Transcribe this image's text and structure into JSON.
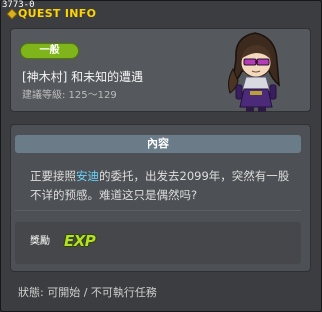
{
  "window": {
    "quest_id": "3773-0",
    "title": "QUEST INFO"
  },
  "quest": {
    "badge": "一般",
    "name": "[神木村] 和未知的遭遇",
    "level_range": "建議等級: 125～129"
  },
  "content": {
    "header": "內容",
    "description_before": "正要接照",
    "npc_name": "安迪",
    "description_after": "的委托，出发去2099年，突然有一股不详的预感。难道这只是偶然吗?"
  },
  "reward": {
    "label": "獎勵",
    "exp_text": "EXP"
  },
  "status": {
    "text": "狀態:  可開始 / 不可執行任務"
  },
  "colors": {
    "title": "#ffd400",
    "badge": "#7fb51a",
    "npc_highlight": "#6ad6ff",
    "content_header": "#697c88",
    "exp": "#b4e02b"
  }
}
